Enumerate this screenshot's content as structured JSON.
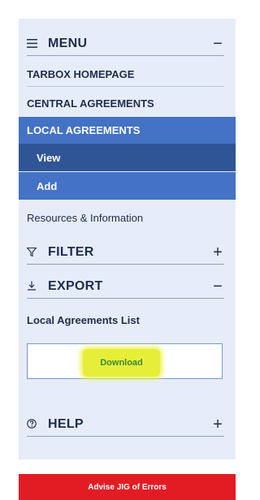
{
  "menu": {
    "title": "MENU",
    "icon": "menu-icon",
    "toggle": "−",
    "items": [
      {
        "label": "TARBOX HOMEPAGE"
      },
      {
        "label": "CENTRAL AGREEMENTS"
      },
      {
        "label": "LOCAL AGREEMENTS",
        "active": true,
        "subitems": [
          {
            "label": "View"
          },
          {
            "label": "Add"
          }
        ]
      },
      {
        "label": "Resources & Information"
      }
    ]
  },
  "filter": {
    "title": "FILTER",
    "icon": "filter-icon",
    "toggle": "+"
  },
  "export": {
    "title": "EXPORT",
    "icon": "download-arrow-icon",
    "toggle": "−",
    "list_label": "Local Agreements List",
    "download_label": "Download"
  },
  "help": {
    "title": "HELP",
    "icon": "help-circle-icon",
    "toggle": "+"
  },
  "advise_button": "Advise JIG of Errors",
  "colors": {
    "panel_bg": "#e6edf8",
    "active_bg": "#4472c4",
    "sub_bg": "#2f5597",
    "text": "#1f2d4d",
    "advise_bg": "#e31c24",
    "highlight": "#e6ee3a"
  }
}
